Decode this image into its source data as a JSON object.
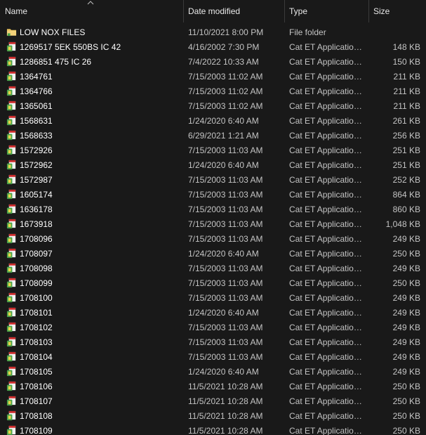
{
  "columns": {
    "name": "Name",
    "date_modified": "Date modified",
    "type": "Type",
    "size": "Size"
  },
  "colors": {
    "background": "#191919",
    "text_primary": "#ffffff",
    "text_secondary": "#c4c4c4",
    "folder_yellow": "#e8c15a",
    "app_icon_green": "#4aa24a",
    "app_icon_red": "#cc2b2b"
  },
  "files": [
    {
      "name": "LOW NOX FILES",
      "date": "11/10/2021 8:00 PM",
      "type": "File folder",
      "size": "",
      "icon": "folder-icon"
    },
    {
      "name": "1269517 5EK 550BS IC 42",
      "date": "4/16/2002 7:30 PM",
      "type": "Cat ET Application...",
      "size": "148 KB",
      "icon": "cat-et-file-icon"
    },
    {
      "name": "1286851 475 IC 26",
      "date": "7/4/2022 10:33 AM",
      "type": "Cat ET Application...",
      "size": "150 KB",
      "icon": "cat-et-file-icon"
    },
    {
      "name": "1364761",
      "date": "7/15/2003 11:02 AM",
      "type": "Cat ET Application...",
      "size": "211 KB",
      "icon": "cat-et-file-icon"
    },
    {
      "name": "1364766",
      "date": "7/15/2003 11:02 AM",
      "type": "Cat ET Application...",
      "size": "211 KB",
      "icon": "cat-et-file-icon"
    },
    {
      "name": "1365061",
      "date": "7/15/2003 11:02 AM",
      "type": "Cat ET Application...",
      "size": "211 KB",
      "icon": "cat-et-file-icon"
    },
    {
      "name": "1568631",
      "date": "1/24/2020 6:40 AM",
      "type": "Cat ET Application...",
      "size": "261 KB",
      "icon": "cat-et-file-icon"
    },
    {
      "name": "1568633",
      "date": "6/29/2021 1:21 AM",
      "type": "Cat ET Application...",
      "size": "256 KB",
      "icon": "cat-et-file-icon"
    },
    {
      "name": "1572926",
      "date": "7/15/2003 11:03 AM",
      "type": "Cat ET Application...",
      "size": "251 KB",
      "icon": "cat-et-file-icon"
    },
    {
      "name": "1572962",
      "date": "1/24/2020 6:40 AM",
      "type": "Cat ET Application...",
      "size": "251 KB",
      "icon": "cat-et-file-icon"
    },
    {
      "name": "1572987",
      "date": "7/15/2003 11:03 AM",
      "type": "Cat ET Application...",
      "size": "252 KB",
      "icon": "cat-et-file-icon"
    },
    {
      "name": "1605174",
      "date": "7/15/2003 11:03 AM",
      "type": "Cat ET Application...",
      "size": "864 KB",
      "icon": "cat-et-file-icon"
    },
    {
      "name": "1636178",
      "date": "7/15/2003 11:03 AM",
      "type": "Cat ET Application...",
      "size": "860 KB",
      "icon": "cat-et-file-icon"
    },
    {
      "name": "1673918",
      "date": "7/15/2003 11:03 AM",
      "type": "Cat ET Application...",
      "size": "1,048 KB",
      "icon": "cat-et-file-icon"
    },
    {
      "name": "1708096",
      "date": "7/15/2003 11:03 AM",
      "type": "Cat ET Application...",
      "size": "249 KB",
      "icon": "cat-et-file-icon"
    },
    {
      "name": "1708097",
      "date": "1/24/2020 6:40 AM",
      "type": "Cat ET Application...",
      "size": "250 KB",
      "icon": "cat-et-file-icon"
    },
    {
      "name": "1708098",
      "date": "7/15/2003 11:03 AM",
      "type": "Cat ET Application...",
      "size": "249 KB",
      "icon": "cat-et-file-icon"
    },
    {
      "name": "1708099",
      "date": "7/15/2003 11:03 AM",
      "type": "Cat ET Application...",
      "size": "250 KB",
      "icon": "cat-et-file-icon"
    },
    {
      "name": "1708100",
      "date": "7/15/2003 11:03 AM",
      "type": "Cat ET Application...",
      "size": "249 KB",
      "icon": "cat-et-file-icon"
    },
    {
      "name": "1708101",
      "date": "1/24/2020 6:40 AM",
      "type": "Cat ET Application...",
      "size": "249 KB",
      "icon": "cat-et-file-icon"
    },
    {
      "name": "1708102",
      "date": "7/15/2003 11:03 AM",
      "type": "Cat ET Application...",
      "size": "249 KB",
      "icon": "cat-et-file-icon"
    },
    {
      "name": "1708103",
      "date": "7/15/2003 11:03 AM",
      "type": "Cat ET Application...",
      "size": "249 KB",
      "icon": "cat-et-file-icon"
    },
    {
      "name": "1708104",
      "date": "7/15/2003 11:03 AM",
      "type": "Cat ET Application...",
      "size": "249 KB",
      "icon": "cat-et-file-icon"
    },
    {
      "name": "1708105",
      "date": "1/24/2020 6:40 AM",
      "type": "Cat ET Application...",
      "size": "249 KB",
      "icon": "cat-et-file-icon"
    },
    {
      "name": "1708106",
      "date": "11/5/2021 10:28 AM",
      "type": "Cat ET Application...",
      "size": "250 KB",
      "icon": "cat-et-file-icon"
    },
    {
      "name": "1708107",
      "date": "11/5/2021 10:28 AM",
      "type": "Cat ET Application...",
      "size": "250 KB",
      "icon": "cat-et-file-icon"
    },
    {
      "name": "1708108",
      "date": "11/5/2021 10:28 AM",
      "type": "Cat ET Application...",
      "size": "250 KB",
      "icon": "cat-et-file-icon"
    },
    {
      "name": "1708109",
      "date": "11/5/2021 10:28 AM",
      "type": "Cat ET Application...",
      "size": "250 KB",
      "icon": "cat-et-file-icon"
    }
  ]
}
